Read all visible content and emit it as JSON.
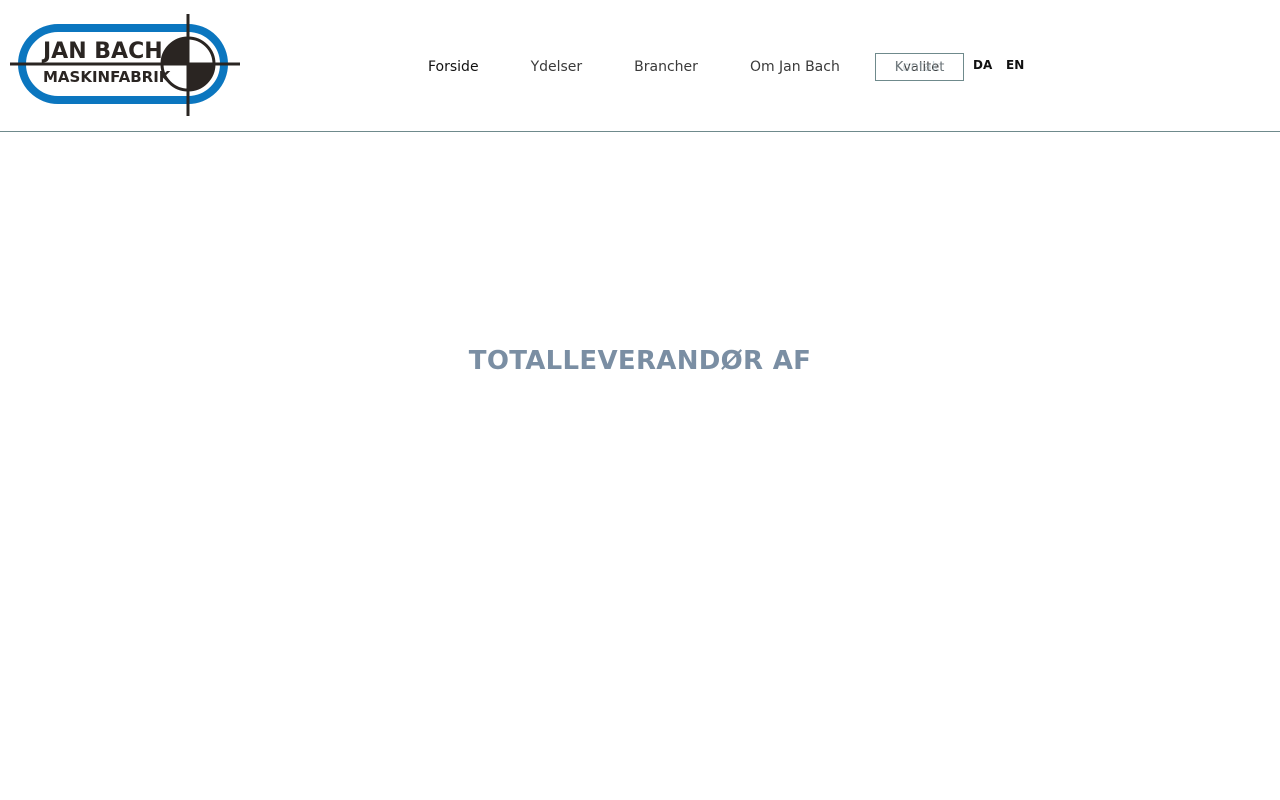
{
  "brand": {
    "line1": "JAN BACH",
    "line2": "MASKINFABRIK",
    "colors": {
      "ring": "#0b76bf",
      "dark": "#2a2522"
    }
  },
  "nav": {
    "items": [
      {
        "label": "Forside",
        "active": true
      },
      {
        "label": "Ydelser"
      },
      {
        "label": "Brancher"
      },
      {
        "label": "Om Jan Bach"
      }
    ],
    "boxed": {
      "label": "Kvalitet",
      "overlay": "Kontakt"
    }
  },
  "languages": [
    "DA",
    "EN"
  ],
  "hero": {
    "title": "TOTALLEVERANDØR AF"
  },
  "colors": {
    "border": "#6f8a8c",
    "hero": "#7a8ea3"
  }
}
